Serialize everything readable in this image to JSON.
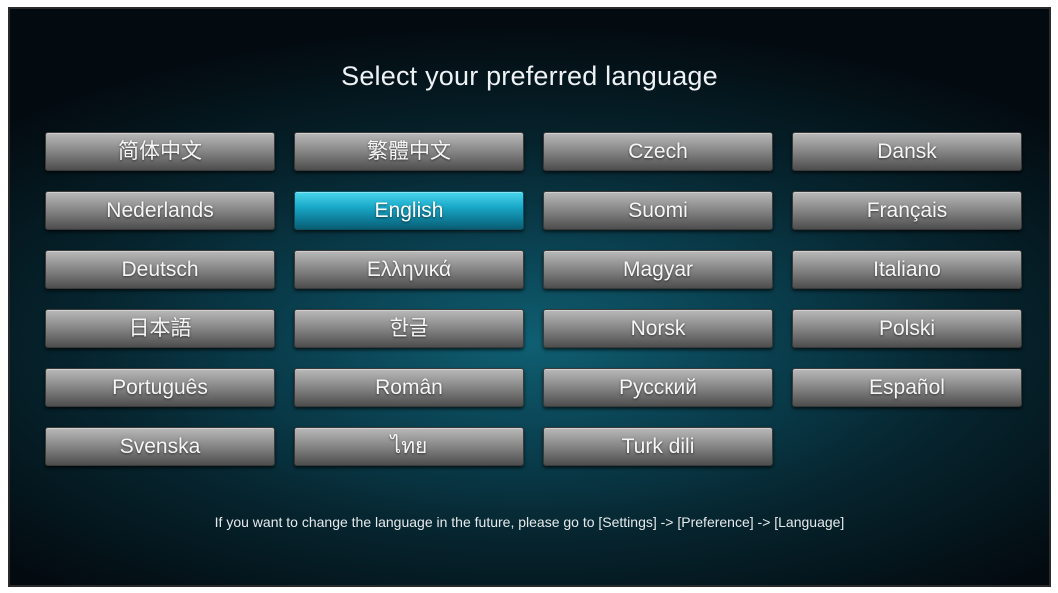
{
  "header": {
    "title": "Select your preferred language"
  },
  "languages": [
    {
      "label": "简体中文",
      "selected": false
    },
    {
      "label": "繁體中文",
      "selected": false
    },
    {
      "label": "Czech",
      "selected": false
    },
    {
      "label": "Dansk",
      "selected": false
    },
    {
      "label": "Nederlands",
      "selected": false
    },
    {
      "label": "English",
      "selected": true
    },
    {
      "label": "Suomi",
      "selected": false
    },
    {
      "label": "Français",
      "selected": false
    },
    {
      "label": "Deutsch",
      "selected": false
    },
    {
      "label": "Ελληνικά",
      "selected": false
    },
    {
      "label": "Magyar",
      "selected": false
    },
    {
      "label": "Italiano",
      "selected": false
    },
    {
      "label": "日本語",
      "selected": false
    },
    {
      "label": "한글",
      "selected": false
    },
    {
      "label": "Norsk",
      "selected": false
    },
    {
      "label": "Polski",
      "selected": false
    },
    {
      "label": "Português",
      "selected": false
    },
    {
      "label": "Român",
      "selected": false
    },
    {
      "label": "Русский",
      "selected": false
    },
    {
      "label": "Español",
      "selected": false
    },
    {
      "label": "Svenska",
      "selected": false
    },
    {
      "label": "ไทย",
      "selected": false
    },
    {
      "label": "Turk dili",
      "selected": false
    }
  ],
  "footer": {
    "hint": "If you want to change the language in the future,  please go to [Settings] -> [Preference] -> [Language]"
  },
  "colors": {
    "accent": "#1aa9c8",
    "button": "#8a8a8a",
    "background": "#0a4252"
  }
}
